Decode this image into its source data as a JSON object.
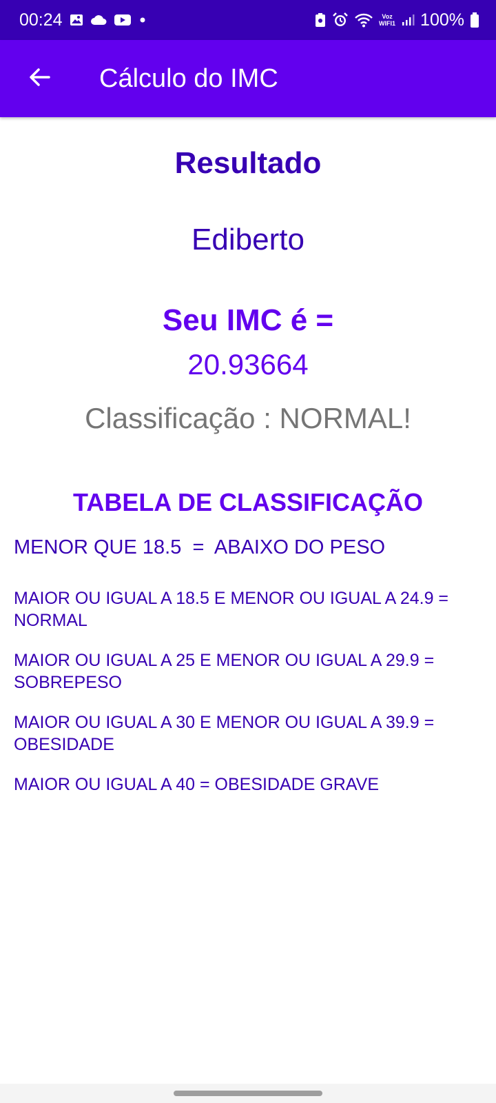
{
  "status_bar": {
    "time": "00:24",
    "voz": "Voz",
    "wifi_label": "WIFI1",
    "battery": "100%"
  },
  "app_bar": {
    "title": "Cálculo do IMC",
    "back_icon": "arrow-back-icon"
  },
  "result": {
    "title": "Resultado",
    "name": "Ediberto",
    "imc_label": "Seu IMC é =",
    "imc_value": "20.93664",
    "classification": "Classificação : NORMAL!"
  },
  "classification_table": {
    "title": "TABELA DE CLASSIFICAÇÃO",
    "rows": [
      "MENOR QUE 18.5  =  ABAIXO DO PESO",
      "MAIOR OU IGUAL A 18.5 E MENOR OU IGUAL A 24.9 = NORMAL",
      "MAIOR OU IGUAL A 25 E MENOR OU IGUAL A 29.9 = SOBREPESO",
      "MAIOR OU IGUAL A 30 E MENOR OU IGUAL A 39.9 = OBESIDADE",
      "MAIOR OU IGUAL A 40 = OBESIDADE GRAVE"
    ]
  },
  "colors": {
    "status_bar": "#3700b3",
    "app_bar": "#6200ee",
    "primary_dark_text": "#3700b3",
    "primary_text": "#6200ee",
    "secondary_text": "#757575"
  }
}
